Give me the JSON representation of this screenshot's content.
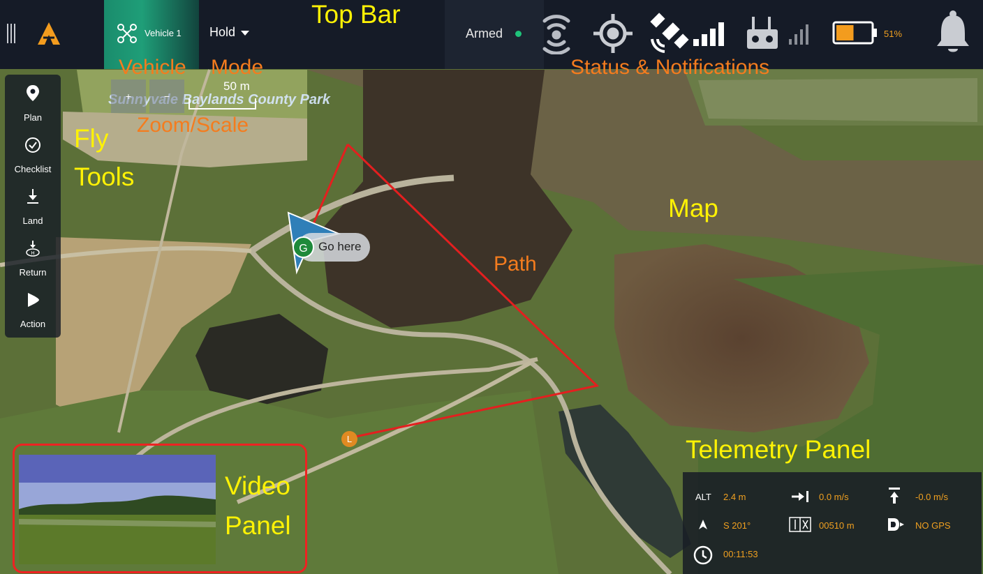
{
  "topbar": {
    "vehicle_label": "Vehicle 1",
    "mode_label": "Hold",
    "armed_label": "Armed",
    "battery_percent": "51%",
    "battery_level": 0.51,
    "icons": [
      "menu-icon",
      "app-logo-icon",
      "drone-icon",
      "telemetry-link-icon",
      "gps-target-icon",
      "satellite-icon",
      "signal-bars-icon",
      "rc-controller-icon",
      "rc-signal-icon",
      "battery-icon",
      "bell-icon"
    ],
    "accent_colors": {
      "vehicle": "#1f9e78",
      "armed": "#1fc37a",
      "battery": "#f0a020"
    }
  },
  "annotations": {
    "top_bar": "Top Bar",
    "vehicle": "Vehicle",
    "mode": "Mode",
    "status": "Status & Notifications",
    "zoom_scale": "Zoom/Scale",
    "fly": "Fly",
    "tools": "Tools",
    "map": "Map",
    "path": "Path",
    "telemetry_panel": "Telemetry Panel",
    "video": "Video",
    "panel": "Panel"
  },
  "flytools": {
    "items": [
      {
        "label": "Plan",
        "icon": "map-pin-icon"
      },
      {
        "label": "Checklist",
        "icon": "check-circle-icon"
      },
      {
        "label": "Land",
        "icon": "land-icon"
      },
      {
        "label": "Return",
        "icon": "return-home-icon"
      },
      {
        "label": "Action",
        "icon": "play-icon"
      }
    ]
  },
  "map": {
    "zoom_in": "+",
    "zoom_out": "−",
    "scale_label": "50 m",
    "park_label": "Sunnyvale Baylands County Park",
    "go_here_badge": "G",
    "go_here_label": "Go here",
    "launch_badge": "L"
  },
  "telemetry": {
    "alt_label": "ALT",
    "alt_value": "2.4 m",
    "hspeed_value": "0.0 m/s",
    "vspeed_value": "-0.0 m/s",
    "heading_value": "S 201°",
    "distance_value": "00510 m",
    "gps_value": "NO GPS",
    "time_value": "00:11:53"
  }
}
